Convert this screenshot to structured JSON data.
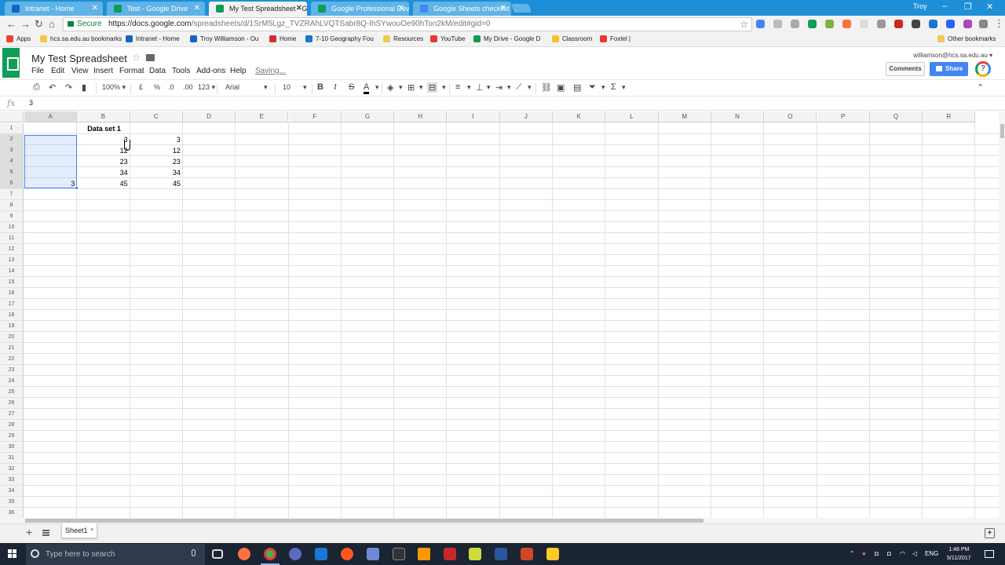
{
  "browser": {
    "tabs": [
      {
        "label": "Intranet - Home",
        "color": "#1565c0",
        "active": false
      },
      {
        "label": "Test - Google Drive",
        "color": "#0f9d58",
        "active": false
      },
      {
        "label": "My Test Spreadsheet - G",
        "color": "#0f9d58",
        "active": true
      },
      {
        "label": "Google Professional Dev",
        "color": "#0f9d58",
        "active": false
      },
      {
        "label": "Google Sheets checklist",
        "color": "#4285f4",
        "active": false
      }
    ],
    "user": "Troy",
    "secure_label": "Secure",
    "url_main": "https://docs.google.com",
    "url_rest": "/spreadsheets/d/1SrM5Lgz_TVZRAhLVQTSabr8Q-IhSYwouOe90hTon2kM/edit#gid=0",
    "bookmarks": [
      {
        "label": "Apps",
        "color": "#ea4335"
      },
      {
        "label": "hcs.sa.edu.au bookmarks",
        "color": "#f2c94c"
      },
      {
        "label": "Intranet - Home",
        "color": "#1565c0"
      },
      {
        "label": "Troy Williamson - Ou",
        "color": "#1565c0"
      },
      {
        "label": "Home",
        "color": "#d32f2f"
      },
      {
        "label": "7-10 Geography Fou",
        "color": "#1976d2"
      },
      {
        "label": "Resources",
        "color": "#f2c94c"
      },
      {
        "label": "YouTube",
        "color": "#e53935"
      },
      {
        "label": "My Drive - Google D",
        "color": "#0f9d58"
      },
      {
        "label": "Classroom",
        "color": "#fbc02d"
      },
      {
        "label": "Foxtel |",
        "color": "#e53935"
      },
      {
        "label": "Other bookmarks",
        "color": "#f2c94c"
      }
    ]
  },
  "sheets": {
    "doc_title": "My Test Spreadsheet",
    "account": "williamson@hcs.sa.edu.au",
    "menu": [
      "File",
      "Edit",
      "View",
      "Insert",
      "Format",
      "Data",
      "Tools",
      "Add-ons",
      "Help"
    ],
    "saving": "Saving...",
    "comments_label": "Comments",
    "share_label": "Share",
    "help_label": "?",
    "toolbar": {
      "zoom": "100%",
      "currency": "£",
      "percent": "%",
      "dec_decrease": ".0",
      "dec_increase": ".00",
      "more_formats": "123",
      "font": "Arial",
      "font_size": "10",
      "bold": "B",
      "italic": "I",
      "strike": "S",
      "text_color": "A"
    },
    "formula_label": "fx",
    "formula_value": "3",
    "columns": [
      "A",
      "B",
      "C",
      "D",
      "E",
      "F",
      "G",
      "H",
      "I",
      "J",
      "K",
      "L",
      "M",
      "N",
      "O",
      "P",
      "Q",
      "R"
    ],
    "rows": [
      "1",
      "2",
      "3",
      "4",
      "5",
      "6",
      "7",
      "8",
      "9",
      "10",
      "11",
      "12",
      "13",
      "14",
      "15",
      "16",
      "17",
      "18",
      "19",
      "20",
      "21",
      "22",
      "23",
      "24",
      "25",
      "26",
      "27",
      "28",
      "29",
      "30",
      "31",
      "32",
      "33",
      "34",
      "35",
      "36"
    ],
    "cells": {
      "B1": "Data set 1",
      "A6": "3",
      "B2": "3",
      "B3": "12",
      "B4": "23",
      "B5": "34",
      "B6": "45",
      "C2": "3",
      "C3": "12",
      "C4": "23",
      "C5": "34",
      "C6": "45"
    },
    "sheet_tab": "Sheet1"
  },
  "taskbar": {
    "search_placeholder": "Type here to search",
    "lang": "ENG",
    "time": "1:48 PM",
    "date": "5/11/2017"
  }
}
